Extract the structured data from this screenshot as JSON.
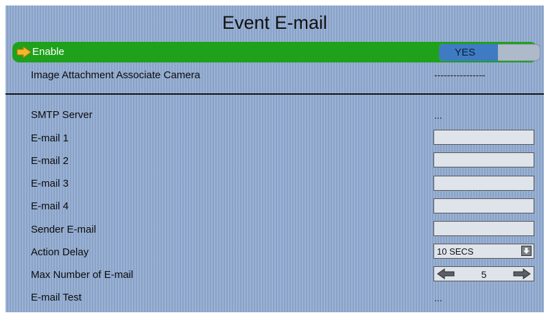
{
  "title": "Event E-mail",
  "enable": {
    "label": "Enable",
    "value": "YES"
  },
  "image_attachment": {
    "label": "Image Attachment Associate Camera",
    "value": "----------------"
  },
  "smtp_server": {
    "label": "SMTP Server",
    "value": "..."
  },
  "email1": {
    "label": "E-mail 1",
    "value": ""
  },
  "email2": {
    "label": "E-mail 2",
    "value": ""
  },
  "email3": {
    "label": "E-mail 3",
    "value": ""
  },
  "email4": {
    "label": "E-mail 4",
    "value": ""
  },
  "sender_email": {
    "label": "Sender E-mail",
    "value": ""
  },
  "action_delay": {
    "label": "Action Delay",
    "value": "10 SECS"
  },
  "max_emails": {
    "label": "Max Number of E-mail",
    "value": "5"
  },
  "email_test": {
    "label": "E-mail Test",
    "value": "..."
  },
  "colors": {
    "background": "#8fa9cf",
    "highlight": "#1fa11c",
    "toggle_on": "#3f7bc2"
  },
  "icons": [
    "arrow-right-icon",
    "chevron-down-icon",
    "arrow-left-icon"
  ]
}
